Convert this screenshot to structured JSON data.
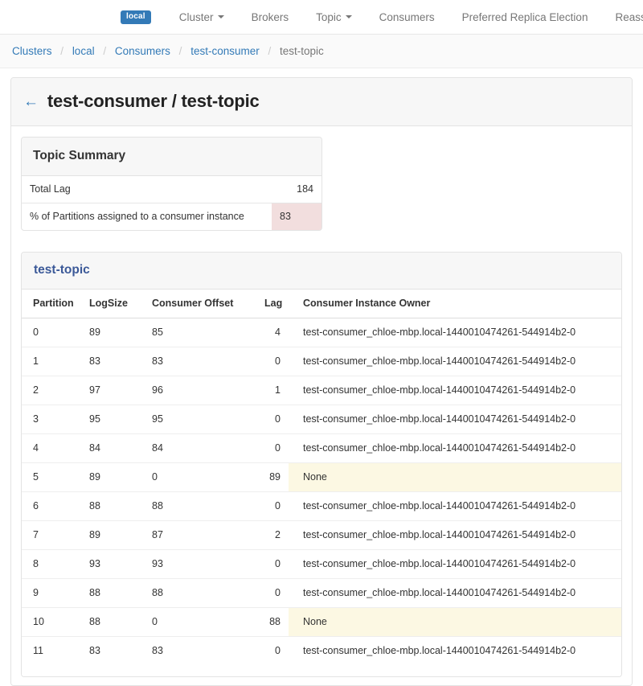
{
  "navbar": {
    "brand_badge": "local",
    "items": [
      {
        "label": "Cluster",
        "has_caret": true
      },
      {
        "label": "Brokers",
        "has_caret": false
      },
      {
        "label": "Topic",
        "has_caret": true
      },
      {
        "label": "Consumers",
        "has_caret": false
      },
      {
        "label": "Preferred Replica Election",
        "has_caret": false
      },
      {
        "label": "Reassign Partitions",
        "has_caret": false
      }
    ]
  },
  "breadcrumb": {
    "items": [
      "Clusters",
      "local",
      "Consumers",
      "test-consumer",
      "test-topic"
    ],
    "separator": "/"
  },
  "page": {
    "back_arrow": "←",
    "title": "test-consumer / test-topic"
  },
  "summary": {
    "title": "Topic Summary",
    "rows": [
      {
        "label": "Total Lag",
        "value": "184",
        "state": "normal"
      },
      {
        "label": "% of Partitions assigned to a consumer instance",
        "value": "83",
        "state": "danger"
      }
    ]
  },
  "topic_table": {
    "title": "test-topic",
    "columns": [
      "Partition",
      "LogSize",
      "Consumer Offset",
      "Lag",
      "Consumer Instance Owner"
    ],
    "rows": [
      {
        "partition": "0",
        "logsize": "89",
        "offset": "85",
        "lag": "4",
        "owner": "test-consumer_chloe-mbp.local-1440010474261-544914b2-0",
        "owner_state": "normal"
      },
      {
        "partition": "1",
        "logsize": "83",
        "offset": "83",
        "lag": "0",
        "owner": "test-consumer_chloe-mbp.local-1440010474261-544914b2-0",
        "owner_state": "normal"
      },
      {
        "partition": "2",
        "logsize": "97",
        "offset": "96",
        "lag": "1",
        "owner": "test-consumer_chloe-mbp.local-1440010474261-544914b2-0",
        "owner_state": "normal"
      },
      {
        "partition": "3",
        "logsize": "95",
        "offset": "95",
        "lag": "0",
        "owner": "test-consumer_chloe-mbp.local-1440010474261-544914b2-0",
        "owner_state": "normal"
      },
      {
        "partition": "4",
        "logsize": "84",
        "offset": "84",
        "lag": "0",
        "owner": "test-consumer_chloe-mbp.local-1440010474261-544914b2-0",
        "owner_state": "normal"
      },
      {
        "partition": "5",
        "logsize": "89",
        "offset": "0",
        "lag": "89",
        "owner": "None",
        "owner_state": "warning"
      },
      {
        "partition": "6",
        "logsize": "88",
        "offset": "88",
        "lag": "0",
        "owner": "test-consumer_chloe-mbp.local-1440010474261-544914b2-0",
        "owner_state": "normal"
      },
      {
        "partition": "7",
        "logsize": "89",
        "offset": "87",
        "lag": "2",
        "owner": "test-consumer_chloe-mbp.local-1440010474261-544914b2-0",
        "owner_state": "normal"
      },
      {
        "partition": "8",
        "logsize": "93",
        "offset": "93",
        "lag": "0",
        "owner": "test-consumer_chloe-mbp.local-1440010474261-544914b2-0",
        "owner_state": "normal"
      },
      {
        "partition": "9",
        "logsize": "88",
        "offset": "88",
        "lag": "0",
        "owner": "test-consumer_chloe-mbp.local-1440010474261-544914b2-0",
        "owner_state": "normal"
      },
      {
        "partition": "10",
        "logsize": "88",
        "offset": "0",
        "lag": "88",
        "owner": "None",
        "owner_state": "warning"
      },
      {
        "partition": "11",
        "logsize": "83",
        "offset": "83",
        "lag": "0",
        "owner": "test-consumer_chloe-mbp.local-1440010474261-544914b2-0",
        "owner_state": "normal"
      }
    ]
  },
  "colors": {
    "accent_blue": "#337ab7",
    "panel_title_blue": "#3b5998",
    "danger_bg": "#f2dede",
    "warning_bg": "#fcf8e3",
    "panel_head_bg": "#f7f7f7",
    "border": "#e3e3e3"
  }
}
